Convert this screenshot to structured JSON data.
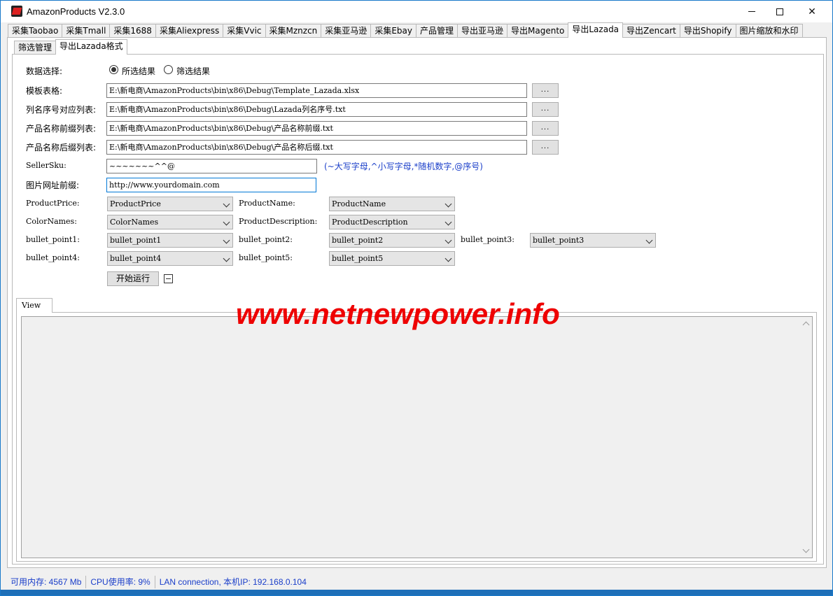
{
  "window": {
    "title": "AmazonProducts V2.3.0"
  },
  "main_tabs": [
    "采集Taobao",
    "采集Tmall",
    "采集1688",
    "采集Aliexpress",
    "采集Vvic",
    "采集Mznzcn",
    "采集亚马逊",
    "采集Ebay",
    "产品管理",
    "导出亚马逊",
    "导出Magento",
    "导出Lazada",
    "导出Zencart",
    "导出Shopify",
    "图片缩放和水印"
  ],
  "sub_tabs": [
    "筛选管理",
    "导出Lazada格式"
  ],
  "form": {
    "data_select_label": "数据选择:",
    "radio_selected": "所选结果",
    "radio_filtered": "筛选结果",
    "template_label": "模板表格:",
    "template_value": "E:\\新电商\\AmazonProducts\\bin\\x86\\Debug\\Template_Lazada.xlsx",
    "columns_label": "列名序号对应列表:",
    "columns_value": "E:\\新电商\\AmazonProducts\\bin\\x86\\Debug\\Lazada列名序号.txt",
    "prefix_label": "产品名称前缀列表:",
    "prefix_value": "E:\\新电商\\AmazonProducts\\bin\\x86\\Debug\\产品名称前缀.txt",
    "suffix_label": "产品名称后缀列表:",
    "suffix_value": "E:\\新电商\\AmazonProducts\\bin\\x86\\Debug\\产品名称后缀.txt",
    "browse_label": "...",
    "sku_label": "SellerSku:",
    "sku_value": "~~~~~~~^^@",
    "sku_hint": "(~大写字母,^小写字母,*随机数字,@序号)",
    "img_prefix_label": "图片网址前缀:",
    "img_prefix_value": "http://www.yourdomain.com",
    "price_label": "ProductPrice:",
    "price_value": "ProductPrice",
    "name_label": "ProductName:",
    "name_value": "ProductName",
    "color_label": "ColorNames:",
    "color_value": "ColorNames",
    "desc_label": "ProductDescription:",
    "desc_value": "ProductDescription",
    "bp1_label": "bullet_point1:",
    "bp1_value": "bullet_point1",
    "bp2_label": "bullet_point2:",
    "bp2_value": "bullet_point2",
    "bp3_label": "bullet_point3:",
    "bp3_value": "bullet_point3",
    "bp4_label": "bullet_point4:",
    "bp4_value": "bullet_point4",
    "bp5_label": "bullet_point5:",
    "bp5_value": "bullet_point5",
    "run_label": "开始运行"
  },
  "view": {
    "tab_label": "View"
  },
  "watermark": "www.netnewpower.info",
  "status": {
    "memory": "可用内存: 4567 Mb",
    "cpu": "CPU使用率: 9%",
    "network": "LAN connection, 本机IP: 192.168.0.104"
  }
}
